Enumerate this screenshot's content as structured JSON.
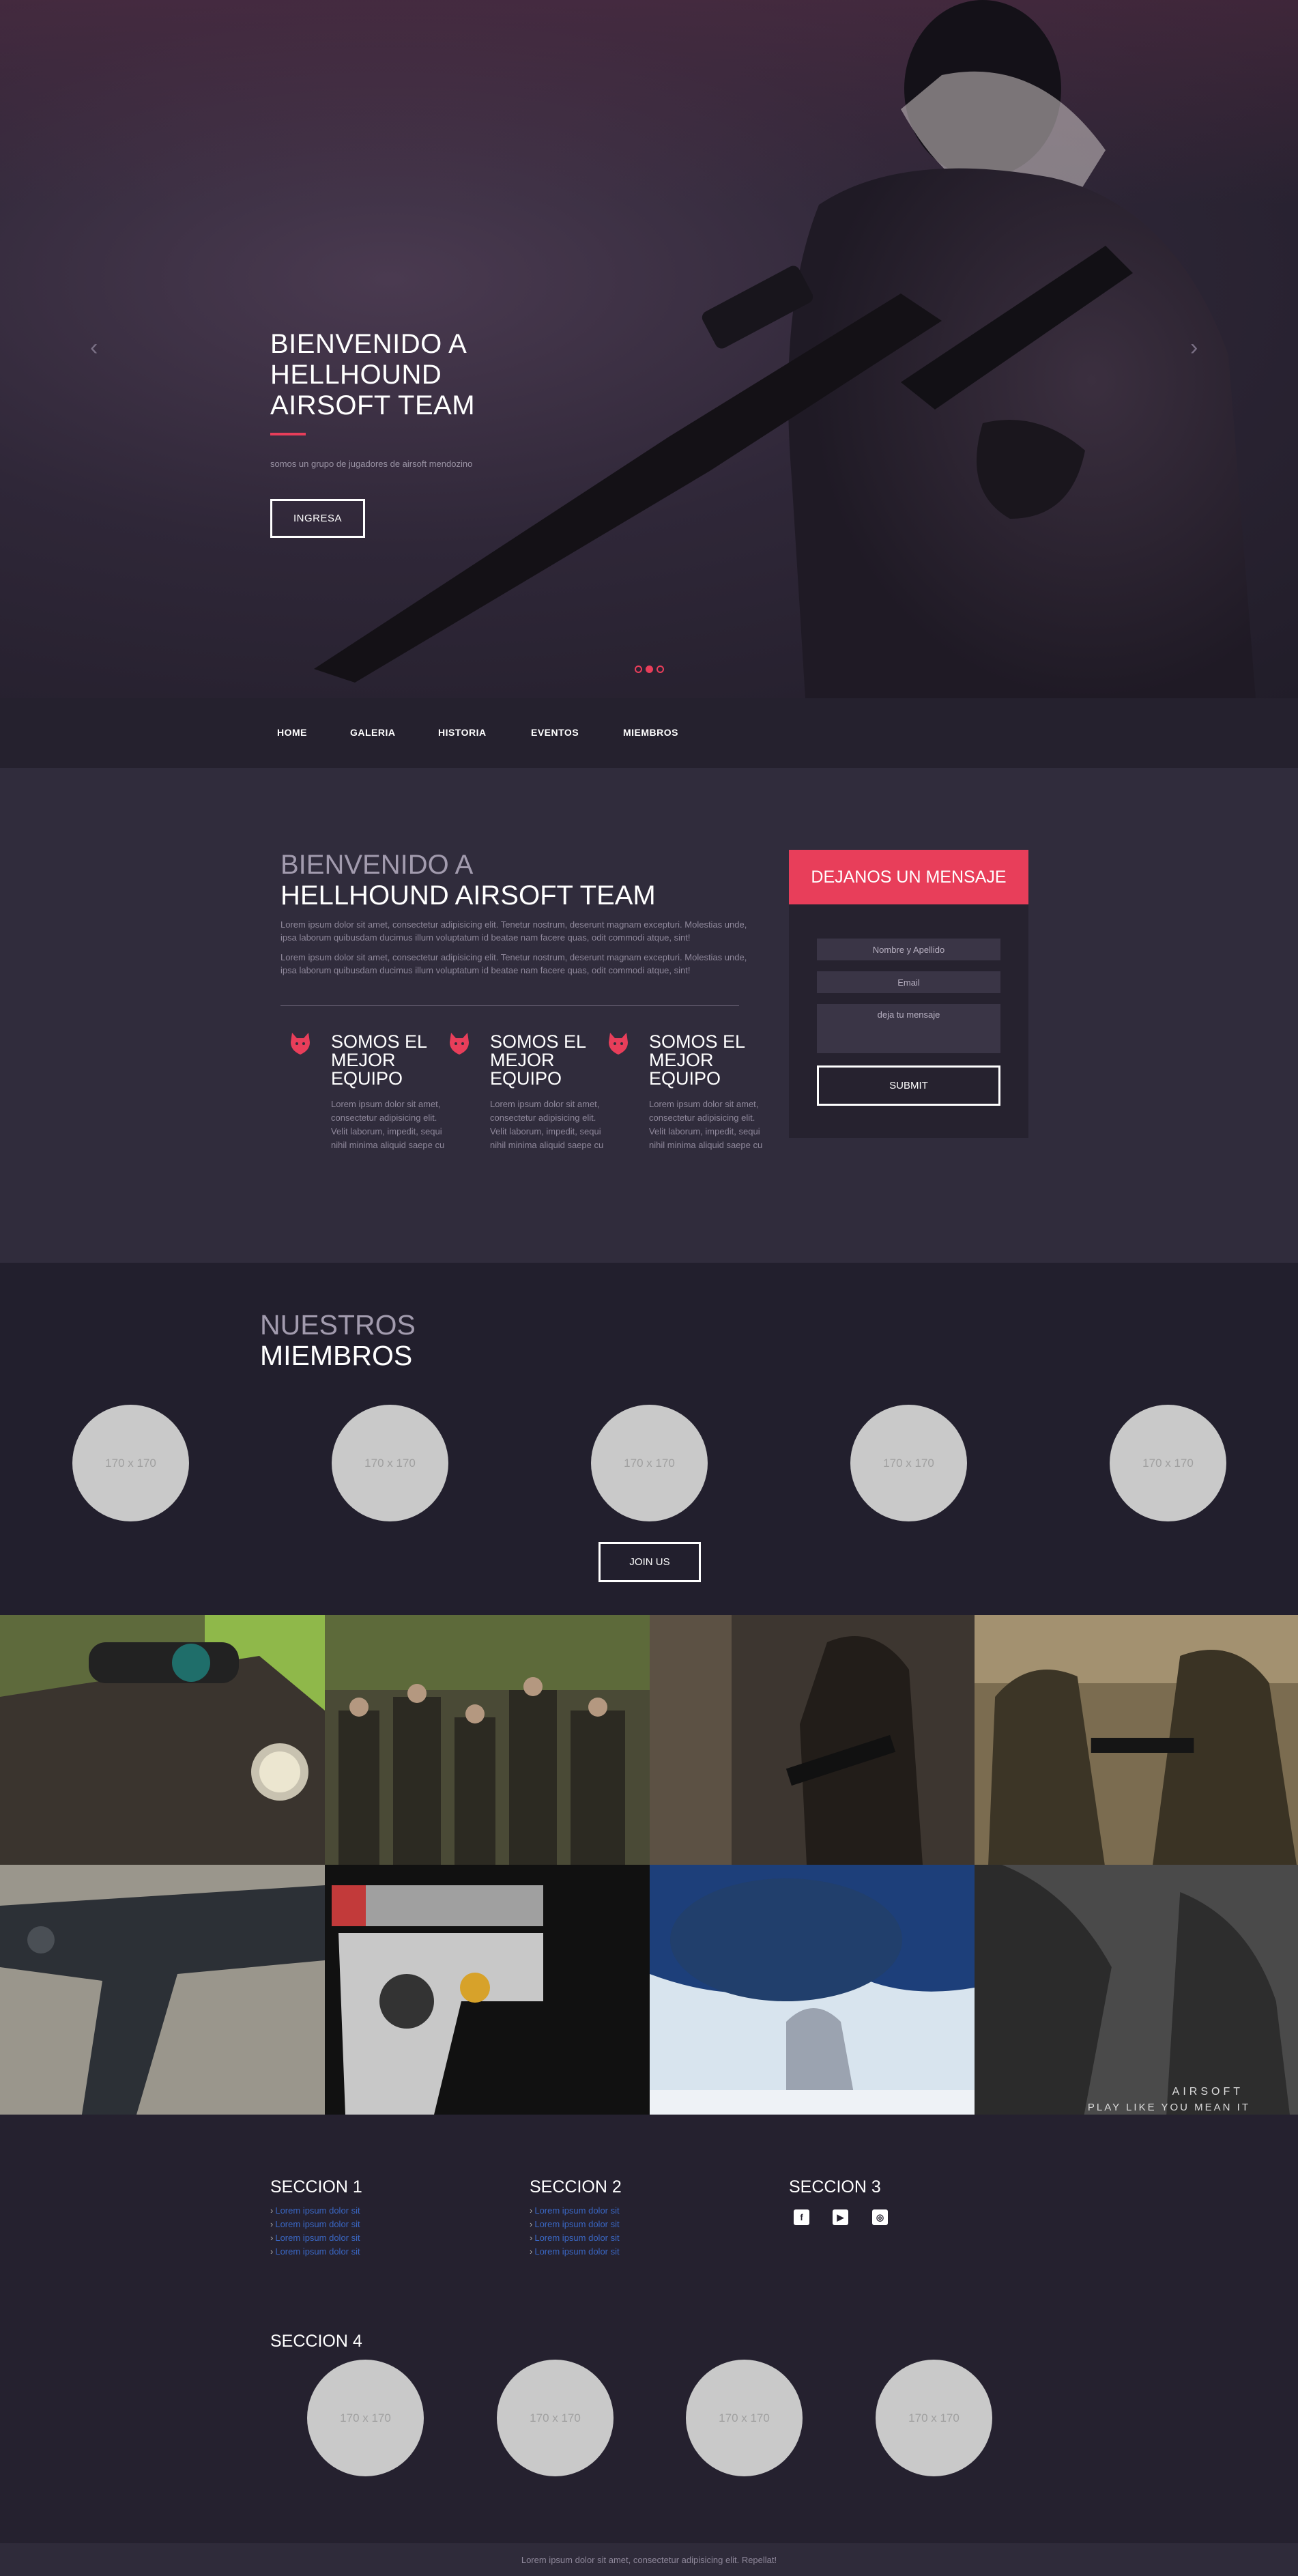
{
  "hero": {
    "title_lines": [
      "BIENVENIDO A",
      "HELLHOUND",
      "AIRSOFT TEAM"
    ],
    "subtitle": "somos un grupo de jugadores de airsoft mendozino",
    "button_label": "INGRESA",
    "prev_arrow": "‹",
    "next_arrow": "›",
    "slides_total": 3,
    "active_slide": 2,
    "accent_color": "#e83e5a"
  },
  "nav": {
    "items": [
      {
        "label": "HOME"
      },
      {
        "label": "GALERIA"
      },
      {
        "label": "HISTORIA"
      },
      {
        "label": "EVENTOS"
      },
      {
        "label": "MIEMBROS"
      }
    ]
  },
  "welcome": {
    "title_line1": "BIENVENIDO A",
    "title_line2": "HELLHOUND AIRSOFT TEAM",
    "paragraphs": [
      "Lorem ipsum dolor sit amet, consectetur adipisicing elit. Tenetur nostrum, deserunt magnam excepturi. Molestias unde, ipsa laborum quibusdam ducimus illum voluptatum id beatae nam facere quas, odit commodi atque, sint!",
      "Lorem ipsum dolor sit amet, consectetur adipisicing elit. Tenetur nostrum, deserunt magnam excepturi. Molestias unde, ipsa laborum quibusdam ducimus illum voluptatum id beatae nam facere quas, odit commodi atque, sint!"
    ],
    "features": [
      {
        "icon": "wolf-icon",
        "title_lines": [
          "SOMOS EL",
          "MEJOR",
          "EQUIPO"
        ],
        "text": "Lorem ipsum dolor sit amet, consectetur adipisicing elit. Velit laborum, impedit, sequi nihil minima aliquid saepe cu"
      },
      {
        "icon": "wolf-icon",
        "title_lines": [
          "SOMOS EL",
          "MEJOR",
          "EQUIPO"
        ],
        "text": "Lorem ipsum dolor sit amet, consectetur adipisicing elit. Velit laborum, impedit, sequi nihil minima aliquid saepe cu"
      },
      {
        "icon": "wolf-icon",
        "title_lines": [
          "SOMOS EL",
          "MEJOR",
          "EQUIPO"
        ],
        "text": "Lorem ipsum dolor sit amet, consectetur adipisicing elit. Velit laborum, impedit, sequi nihil minima aliquid saepe cu"
      }
    ]
  },
  "contact_form": {
    "heading": "DEJANOS UN MENSAJE",
    "name_placeholder": "Nombre y Apellido",
    "email_placeholder": "Email",
    "message_placeholder": "deja tu mensaje",
    "submit_label": "SUBMIT"
  },
  "members": {
    "title_line1": "NUESTROS",
    "title_line2": "MIEMBROS",
    "avatars": [
      "170 x 170",
      "170 x 170",
      "170 x 170",
      "170 x 170",
      "170 x 170"
    ],
    "join_label": "JOIN US"
  },
  "gallery": {
    "photos": [
      {
        "name": "rifle-scope-photo"
      },
      {
        "name": "team-group-photo"
      },
      {
        "name": "players-in-field-photo"
      },
      {
        "name": "soldiers-aiming-photo"
      },
      {
        "name": "vector-smg-photo"
      },
      {
        "name": "gearbox-photo"
      },
      {
        "name": "smoke-grenade-photo"
      },
      {
        "name": "gloved-hands-photo"
      }
    ],
    "watermark_line1": "AIRSOFT",
    "watermark_line2": "PLAY LIKE YOU MEAN IT"
  },
  "footer": {
    "sections": [
      {
        "title": "SECCION 1",
        "links": [
          "Lorem ipsum dolor sit",
          "Lorem ipsum dolor sit",
          "Lorem ipsum dolor sit",
          "Lorem ipsum dolor sit"
        ]
      },
      {
        "title": "SECCION 2",
        "links": [
          "Lorem ipsum dolor sit",
          "Lorem ipsum dolor sit",
          "Lorem ipsum dolor sit",
          "Lorem ipsum dolor sit"
        ]
      },
      {
        "title": "SECCION 3",
        "social": [
          {
            "icon": "facebook-icon",
            "glyph": "f"
          },
          {
            "icon": "youtube-icon",
            "glyph": "▶"
          },
          {
            "icon": "instagram-icon",
            "glyph": "◎"
          }
        ]
      },
      {
        "title": "SECCION 4",
        "avatars": [
          "170 x 170",
          "170 x 170",
          "170 x 170",
          "170 x 170"
        ]
      }
    ],
    "copyright": "Lorem ipsum dolor sit amet, consectetur adipisicing elit. Repellat!"
  }
}
